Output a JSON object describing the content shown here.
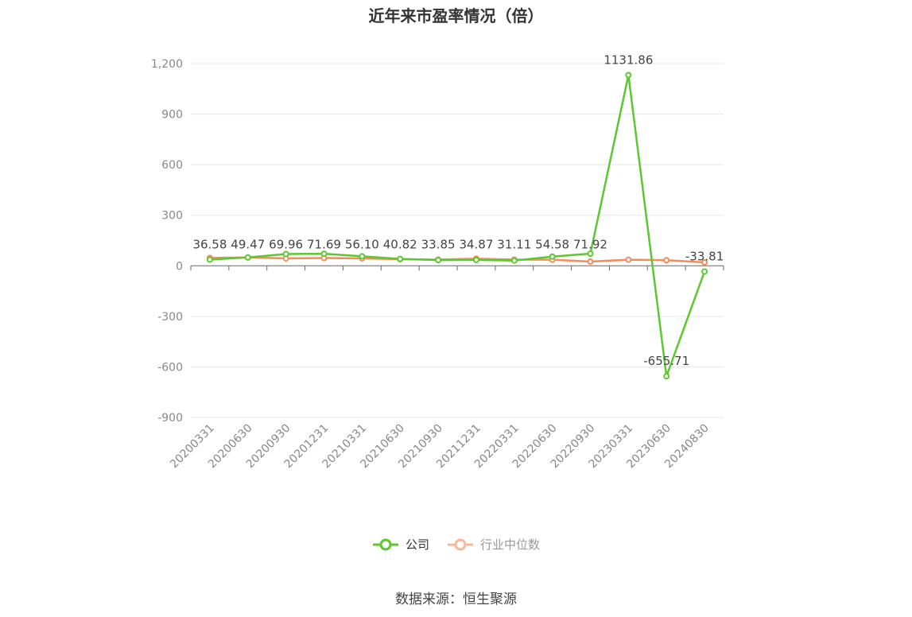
{
  "chart_data": {
    "type": "line",
    "title": "近年来市盈率情况（倍）",
    "categories": [
      "20200331",
      "20200630",
      "20200930",
      "20201231",
      "20210331",
      "20210630",
      "20210930",
      "20211231",
      "20220331",
      "20220630",
      "20220930",
      "20230331",
      "20230630",
      "20240830"
    ],
    "series": [
      {
        "name": "公司",
        "color": "#5cc72e",
        "values": [
          36.58,
          49.47,
          69.96,
          71.69,
          56.1,
          40.82,
          33.85,
          34.87,
          31.11,
          54.58,
          71.92,
          1131.86,
          -655.71,
          -33.81
        ],
        "labels": [
          "36.58",
          "49.47",
          "69.96",
          "71.69",
          "56.10",
          "40.82",
          "33.85",
          "34.87",
          "31.11",
          "54.58",
          "71.92",
          "1131.86",
          "-655.71",
          "-33.81"
        ]
      },
      {
        "name": "行业中位数",
        "color": "#f28c5a",
        "values": [
          47,
          50,
          44,
          46,
          44,
          39,
          37,
          42,
          37,
          36,
          25,
          36,
          33,
          20
        ]
      }
    ],
    "ylim": [
      -900,
      1200
    ],
    "yticks": [
      1200,
      900,
      600,
      300,
      0,
      -300,
      -600,
      -900
    ],
    "ytick_labels": [
      "1,200",
      "900",
      "600",
      "300",
      "0",
      "-300",
      "-600",
      "-900"
    ],
    "grid": true,
    "legend_position": "bottom"
  },
  "source_text": "数据来源：恒生聚源"
}
